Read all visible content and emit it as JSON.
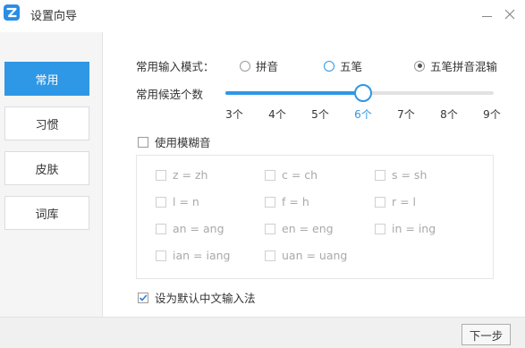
{
  "window": {
    "title": "设置向导",
    "logo_icon": "zi-logo-icon",
    "minimize_icon": "minimize-icon",
    "close_icon": "close-icon"
  },
  "sidebar": {
    "items": [
      {
        "label": "常用",
        "active": true
      },
      {
        "label": "习惯",
        "active": false
      },
      {
        "label": "皮肤",
        "active": false
      },
      {
        "label": "词库",
        "active": false
      }
    ]
  },
  "input_mode": {
    "label": "常用输入模式：",
    "options": [
      {
        "label": "拼音",
        "checked": false
      },
      {
        "label": "五笔",
        "checked": false
      },
      {
        "label": "五笔拼音混输",
        "checked": true
      }
    ]
  },
  "candidates": {
    "label": "常用候选个数",
    "ticks": [
      "3个",
      "4个",
      "5个",
      "6个",
      "7个",
      "8个",
      "9个"
    ],
    "selected_index": 3
  },
  "fuzzy": {
    "label": "使用模糊音",
    "checked": false,
    "pairs": [
      "z = zh",
      "c = ch",
      "s = sh",
      "l = n",
      "f = h",
      "r = l",
      "an = ang",
      "en = eng",
      "in = ing",
      "ian = iang",
      "uan = uang"
    ]
  },
  "default_ime": {
    "label": "设为默认中文输入法",
    "checked": true
  },
  "footer": {
    "next_label": "下一步"
  },
  "colors": {
    "accent": "#2e97e6",
    "sidebar_bg": "#f5f5f5",
    "disabled_text": "#a9a9a9"
  }
}
